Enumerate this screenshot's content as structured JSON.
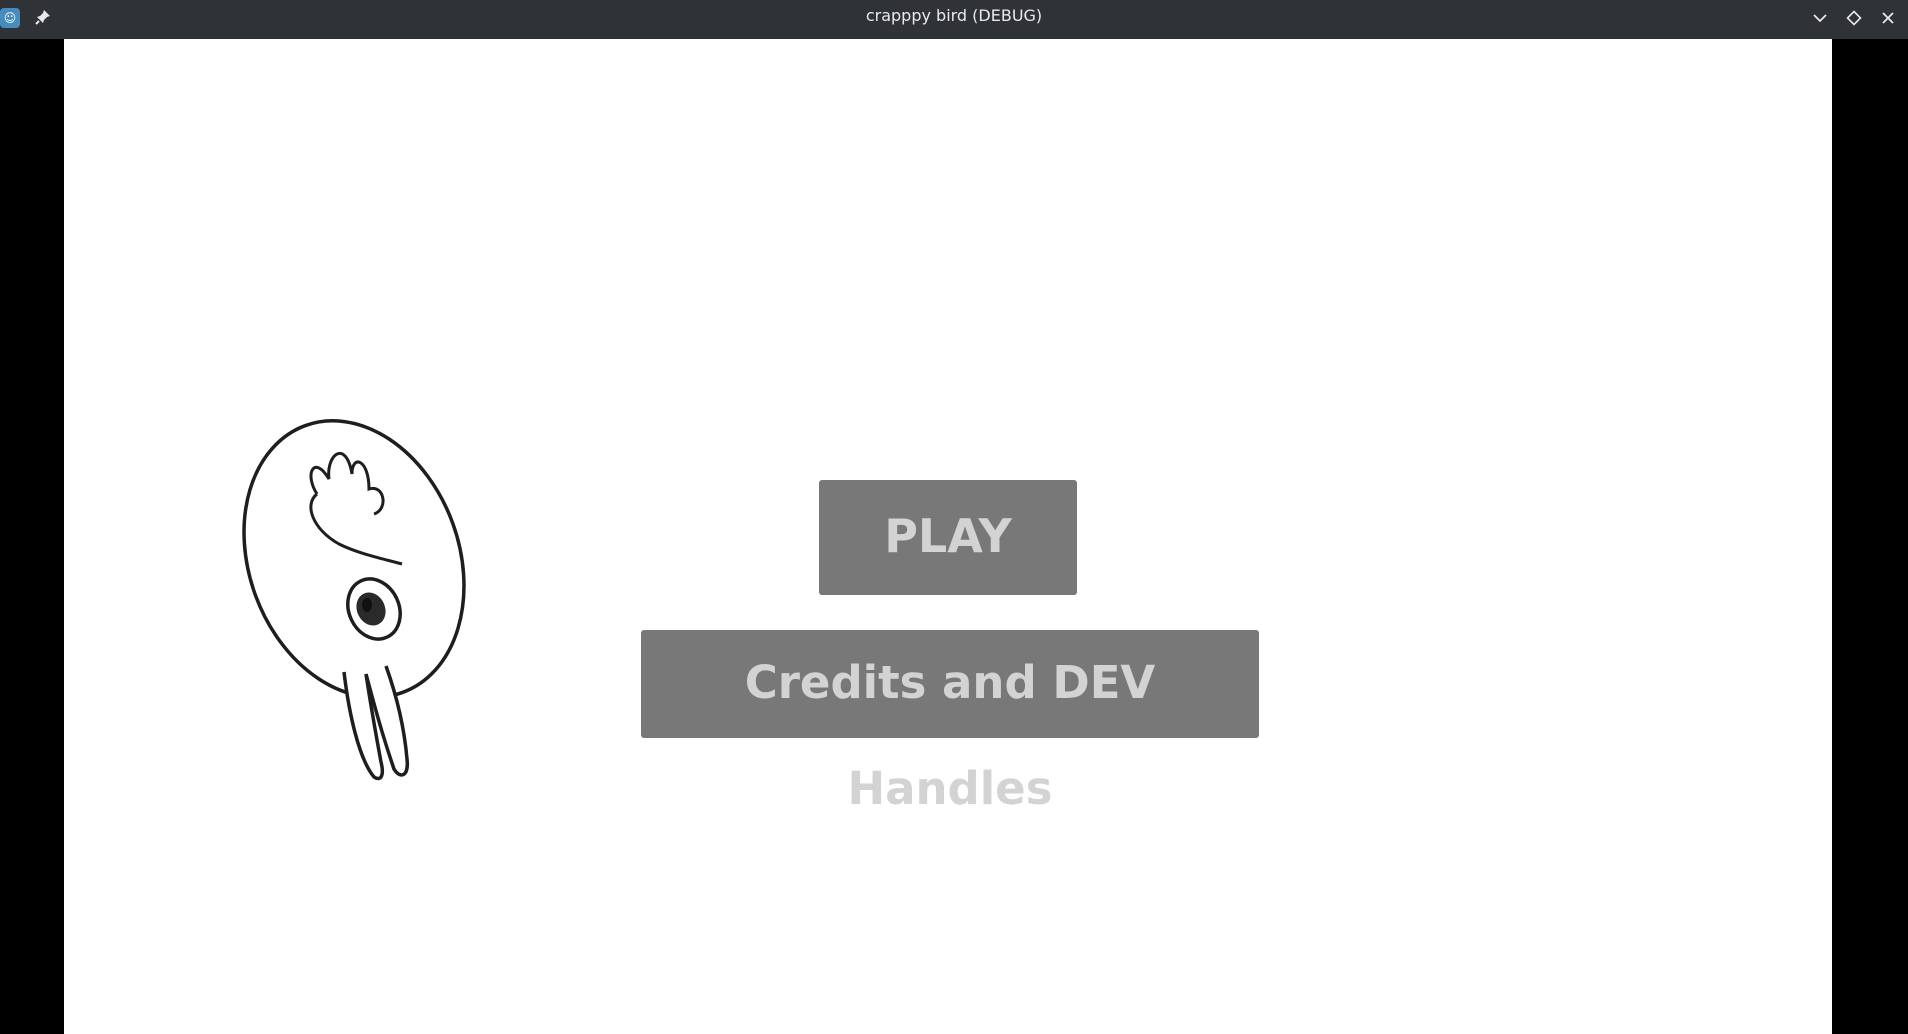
{
  "window": {
    "title": "crapppy bird (DEBUG)",
    "icons": {
      "app": "godot-icon",
      "pin": "pin-icon",
      "minimize": "chevron-down-icon",
      "maximize": "diamond-icon",
      "close": "close-icon"
    },
    "colors": {
      "titlebar": "#2f3338",
      "letterbox": "#000000",
      "game_background": "#ffffff"
    }
  },
  "menu": {
    "play_label": "PLAY",
    "credits_label": "Credits and DEV Handles",
    "button_color": "#787878",
    "button_text_color": "#d3d3d3"
  },
  "scene": {
    "bird_icon": "bird-sprite"
  }
}
